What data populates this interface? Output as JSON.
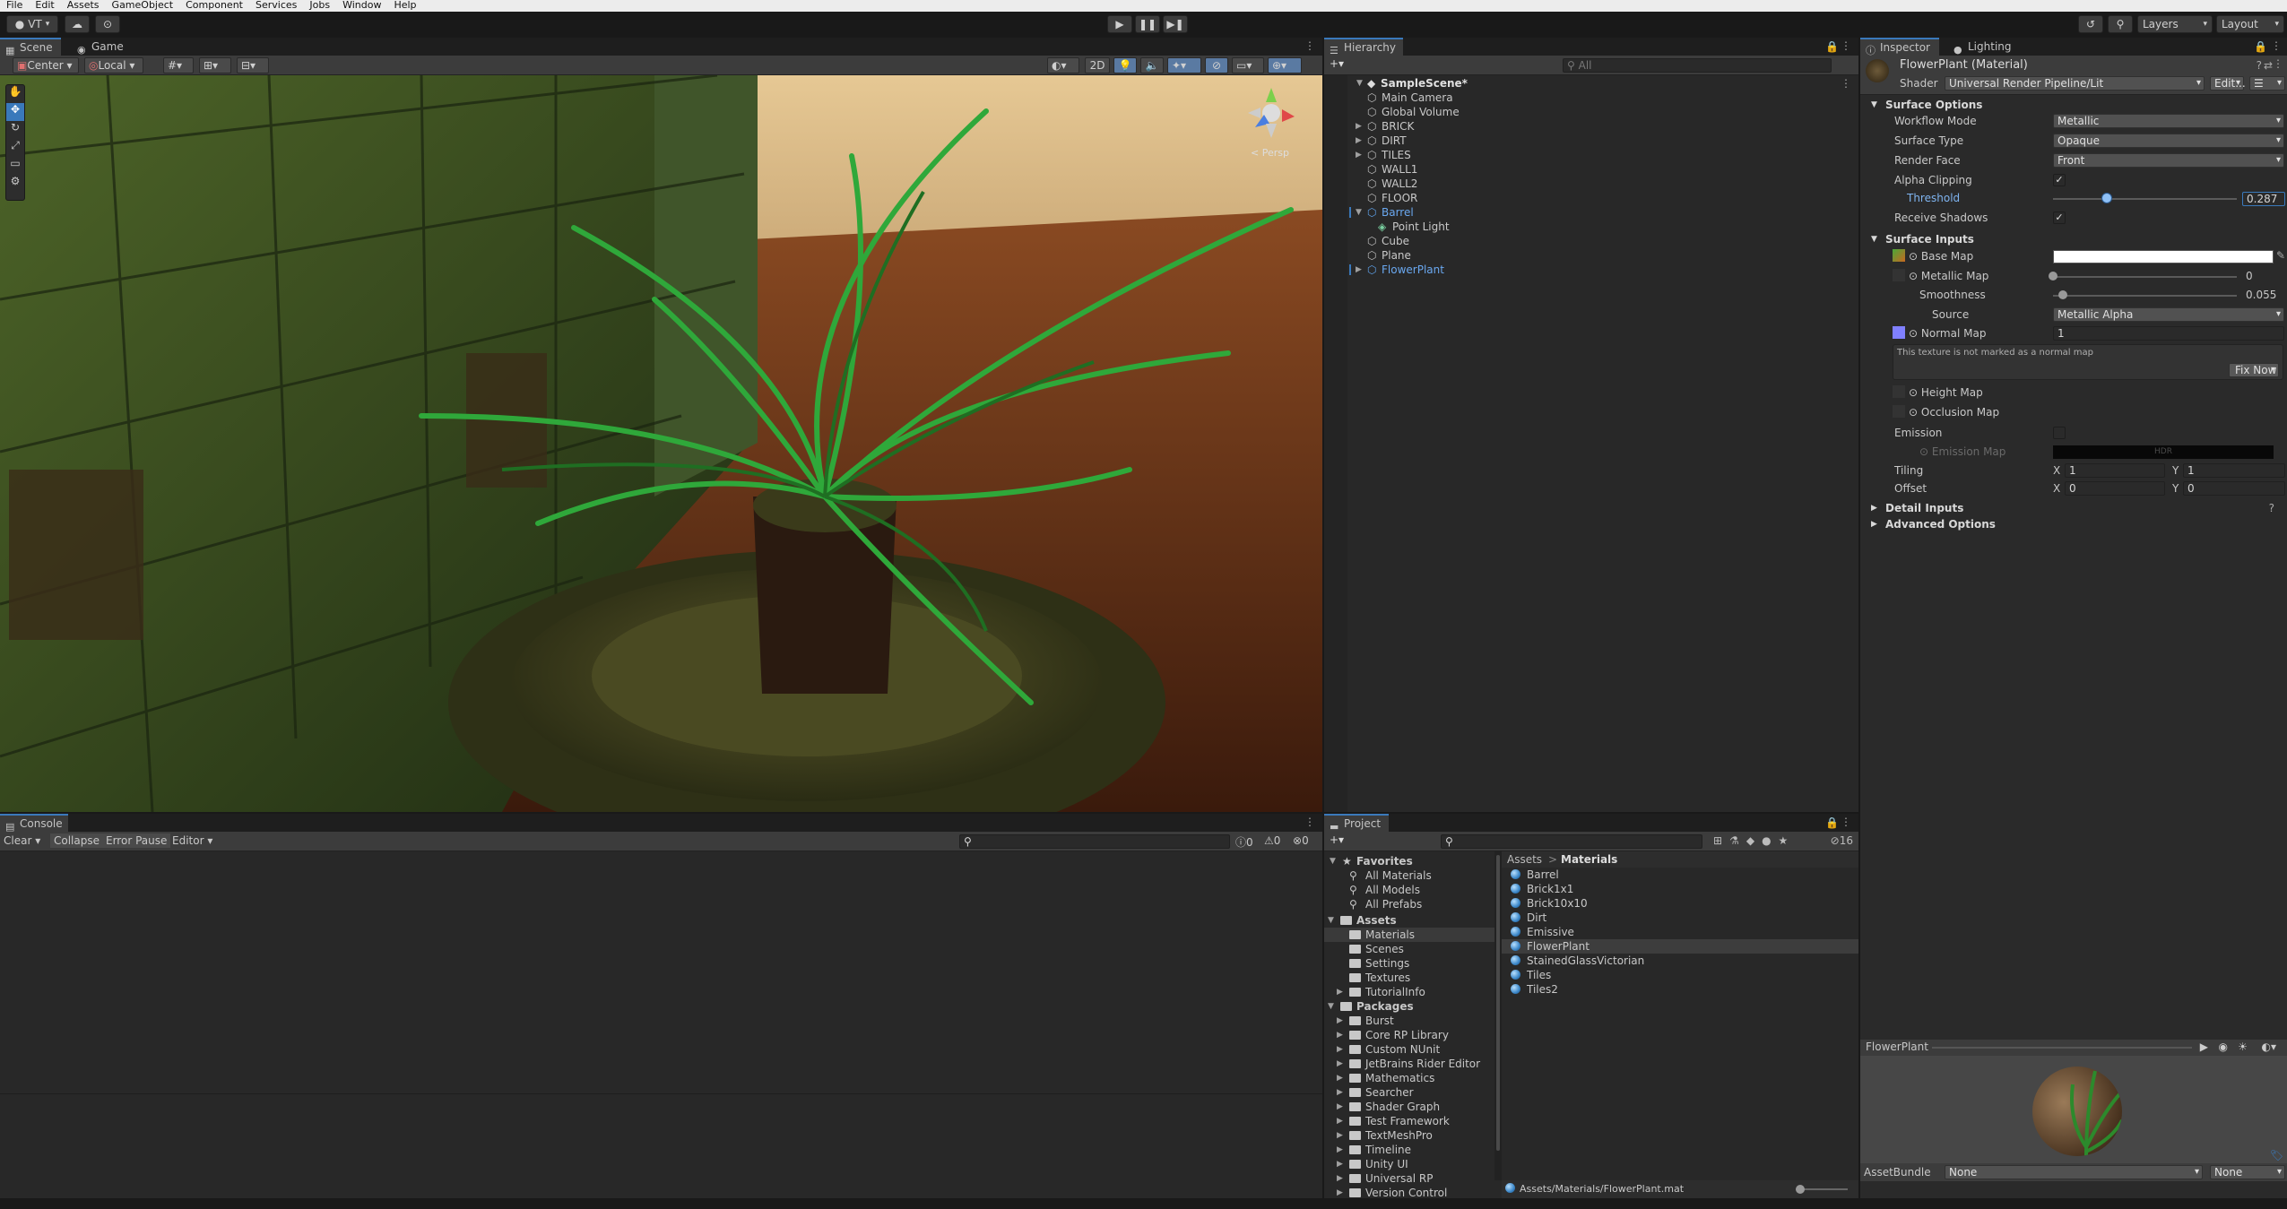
{
  "menu": [
    "File",
    "Edit",
    "Assets",
    "GameObject",
    "Component",
    "Services",
    "Jobs",
    "Window",
    "Help"
  ],
  "toolbar": {
    "account": "VT",
    "layers": "Layers",
    "layout": "Layout"
  },
  "scene": {
    "tabs": [
      {
        "label": "Scene"
      },
      {
        "label": "Game"
      }
    ],
    "pivot": "Center",
    "space": "Local",
    "toggle_2d": "2D",
    "persp": "< Persp"
  },
  "hierarchy": {
    "title": "Hierarchy",
    "search_placeholder": "All",
    "scene_name": "SampleScene*",
    "items": [
      "Main Camera",
      "Global Volume",
      "BRICK",
      "DIRT",
      "TILES",
      "WALL1",
      "WALL2",
      "FLOOR",
      "Barrel",
      "Point Light",
      "Cube",
      "Plane",
      "FlowerPlant"
    ]
  },
  "inspector": {
    "tabs": [
      {
        "label": "Inspector"
      },
      {
        "label": "Lighting"
      }
    ],
    "object_name": "FlowerPlant (Material)",
    "shader_label": "Shader",
    "shader_value": "Universal Render Pipeline/Lit",
    "edit_button": "Edit...",
    "surface_options": "Surface Options",
    "workflow_mode_label": "Workflow Mode",
    "workflow_mode": "Metallic",
    "surface_type_label": "Surface Type",
    "surface_type": "Opaque",
    "render_face_label": "Render Face",
    "render_face": "Front",
    "alpha_clipping_label": "Alpha Clipping",
    "threshold_label": "Threshold",
    "threshold_value": "0.287",
    "threshold_level": 0.287,
    "receive_shadows_label": "Receive Shadows",
    "surface_inputs": "Surface Inputs",
    "base_map_label": "Base Map",
    "metallic_map_label": "Metallic Map",
    "metallic_value": "0",
    "metallic_level": 0,
    "smoothness_label": "Smoothness",
    "smoothness_value": "0.055",
    "smoothness_level": 0.055,
    "source_label": "Source",
    "source_value": "Metallic Alpha",
    "normal_map_label": "Normal Map",
    "normal_map_value": "1",
    "normal_warning": "This texture is not marked as a normal map",
    "fix_now": "Fix Now",
    "height_map_label": "Height Map",
    "occlusion_map_label": "Occlusion Map",
    "emission_label": "Emission",
    "emission_map_label": "Emission Map",
    "hdr": "HDR",
    "tiling_label": "Tiling",
    "tiling_x": "1",
    "tiling_y": "1",
    "offset_label": "Offset",
    "offset_x": "0",
    "offset_y": "0",
    "x": "X",
    "y": "Y",
    "detail_inputs": "Detail Inputs",
    "advanced_options": "Advanced Options",
    "preview_name": "FlowerPlant",
    "assetbundle_label": "AssetBundle",
    "assetbundle_value": "None",
    "assetbundle_variant": "None"
  },
  "console": {
    "title": "Console",
    "clear": "Clear",
    "collapse": "Collapse",
    "error_pause": "Error Pause",
    "editor": "Editor",
    "count_log": "0",
    "count_warn": "0",
    "count_error": "0"
  },
  "project": {
    "title": "Project",
    "hidden_count": "16",
    "favorites": "Favorites",
    "favorite_items": [
      "All Materials",
      "All Models",
      "All Prefabs"
    ],
    "assets": "Assets",
    "asset_folders": [
      "Materials",
      "Scenes",
      "Settings",
      "Textures",
      "TutorialInfo"
    ],
    "packages": "Packages",
    "package_folders": [
      "Burst",
      "Core RP Library",
      "Custom NUnit",
      "JetBrains Rider Editor",
      "Mathematics",
      "Searcher",
      "Shader Graph",
      "Test Framework",
      "TextMeshPro",
      "Timeline",
      "Unity UI",
      "Universal RP",
      "Version Control"
    ],
    "breadcrumb": [
      "Assets",
      "Materials"
    ],
    "materials": [
      "Barrel",
      "Brick1x1",
      "Brick10x10",
      "Dirt",
      "Emissive",
      "FlowerPlant",
      "StainedGlassVictorian",
      "Tiles",
      "Tiles2"
    ],
    "path": "Assets/Materials/FlowerPlant.mat"
  },
  "colors": {
    "accent": "#3a79bb",
    "selection": "#2c5d87",
    "panel": "#282828",
    "header": "#3c3c3c"
  }
}
